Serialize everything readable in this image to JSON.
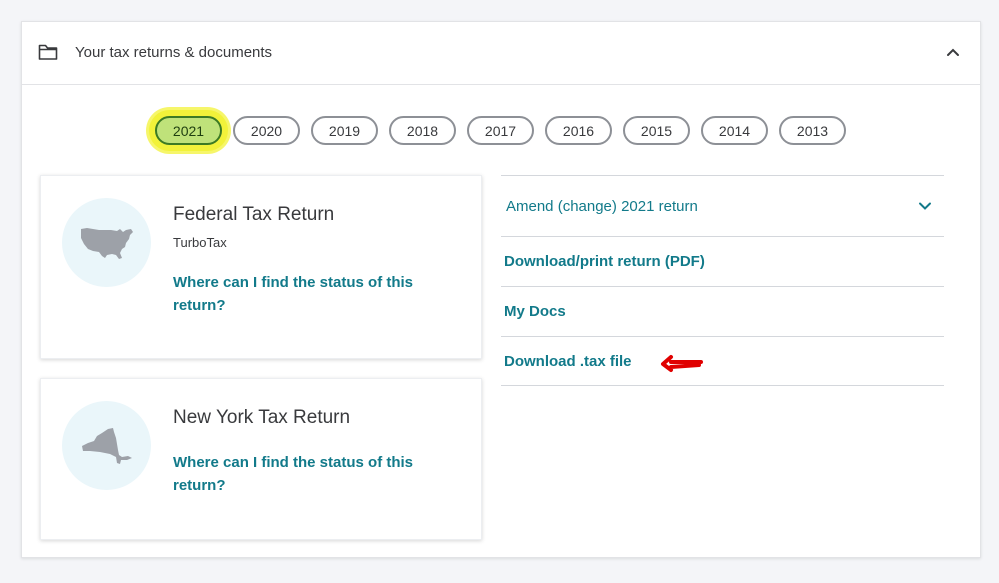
{
  "header": {
    "title": "Your tax returns & documents"
  },
  "years": [
    "2021",
    "2020",
    "2019",
    "2018",
    "2017",
    "2016",
    "2015",
    "2014",
    "2013"
  ],
  "selected_year": "2021",
  "federal": {
    "title": "Federal Tax Return",
    "subtitle": "TurboTax",
    "status_link": "Where can I find the status of this return?"
  },
  "state": {
    "title": "New York Tax Return",
    "status_link": "Where can I find the status of this return?"
  },
  "actions": {
    "amend": "Amend (change) 2021 return",
    "download_pdf": "Download/print return (PDF)",
    "my_docs": "My Docs",
    "download_tax": "Download .tax file"
  },
  "colors": {
    "link": "#127a8a",
    "highlight": "#f2f23a",
    "selected_fill": "#bfe27a",
    "annotation_arrow": "#e00000"
  },
  "icons": {
    "header": "folder-icon",
    "collapse": "chevron-up-icon",
    "amend_expand": "chevron-down-icon",
    "federal_map": "usa-map-icon",
    "state_map": "new-york-map-icon",
    "annotation": "red-arrow-icon"
  }
}
